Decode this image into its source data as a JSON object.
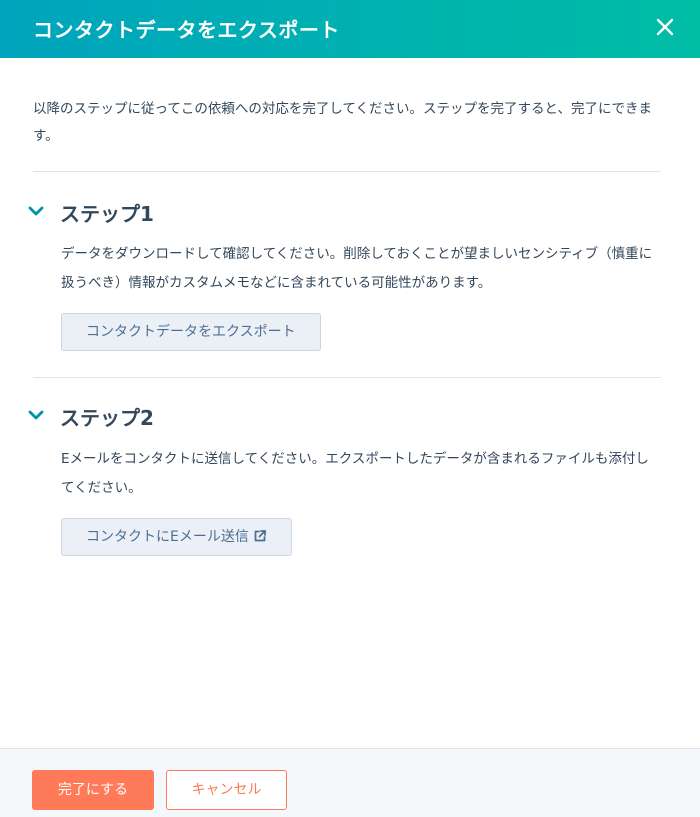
{
  "dialog": {
    "title": "コンタクトデータをエクスポート",
    "close_icon": "close-icon"
  },
  "intro": "以降のステップに従ってこの依頼への対応を完了してください。ステップを完了すると、完了にできます。",
  "steps": [
    {
      "title": "ステップ1",
      "description": "データをダウンロードして確認してください。削除しておくことが望ましいセンシティブ（慎重に扱うべき）情報がカスタムメモなどに含まれている可能性があります。",
      "button_label": "コンタクトデータをエクスポート",
      "icon": "chevron-down-icon"
    },
    {
      "title": "ステップ2",
      "description": "Eメールをコンタクトに送信してください。エクスポートしたデータが含まれるファイルも添付してください。",
      "button_label": "コンタクトにEメール送信",
      "icon": "chevron-down-icon",
      "button_icon": "external-link-icon"
    }
  ],
  "footer": {
    "complete_label": "完了にする",
    "cancel_label": "キャンセル"
  },
  "colors": {
    "header_gradient_start": "#00a4bd",
    "header_gradient_end": "#00bda5",
    "primary": "#ff7a59",
    "text": "#33475b",
    "secondary_button_bg": "#eaf0f6",
    "secondary_button_text": "#506e91",
    "chevron": "#0091ae"
  }
}
